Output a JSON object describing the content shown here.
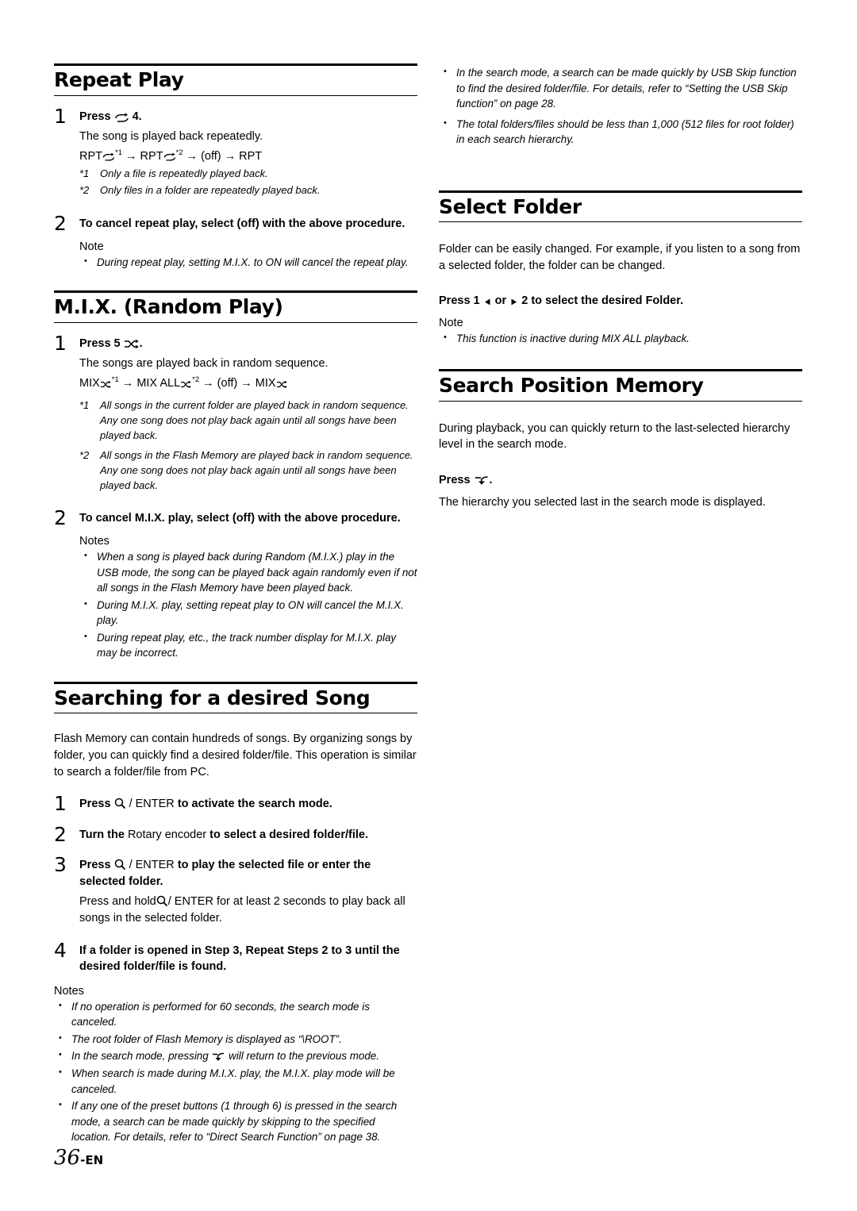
{
  "page": {
    "number": "36",
    "lang_suffix": "-EN"
  },
  "left_column": {
    "repeat_play": {
      "heading": "Repeat Play",
      "step1": {
        "num": "1",
        "title_pre": "Press",
        "title_post": "4.",
        "icon": "repeat-icon",
        "body": "The song is played back repeatedly.",
        "sequence_parts": [
          "RPT",
          "*1",
          " → ",
          "RPT",
          "*2",
          " → (off) → RPT"
        ],
        "footnote1_mark": "*1",
        "footnote1": "Only a file is repeatedly played back.",
        "footnote2_mark": "*2",
        "footnote2": "Only files in a folder are repeatedly played back."
      },
      "step2": {
        "num": "2",
        "title": "To cancel repeat play, select (off) with the above procedure.",
        "note_label": "Note",
        "notes": [
          "During repeat play, setting M.I.X. to ON will cancel the repeat play."
        ]
      }
    },
    "mix_random_play": {
      "heading": "M.I.X. (Random Play)",
      "step1": {
        "num": "1",
        "title_pre": "Press 5",
        "title_post": ".",
        "icon": "shuffle-icon",
        "body": "The songs are played back in random sequence.",
        "sequence_parts": [
          "MIX",
          "*1",
          " → MIX ALL",
          "*2",
          " → (off) → MIX"
        ],
        "footnote1_mark": "*1",
        "footnote1": "All songs in the current folder are played back in random sequence. Any one song does not play back again until all songs have been played back.",
        "footnote2_mark": "*2",
        "footnote2": "All songs in the Flash Memory are played back in random sequence. Any one song does not play back again until all songs have been played back."
      },
      "step2": {
        "num": "2",
        "title": "To cancel M.I.X. play, select (off) with the above procedure.",
        "notes_label": "Notes",
        "notes": [
          "When a song is played back during Random (M.I.X.) play in the USB mode, the song can be played back again randomly even if not all songs in the Flash Memory have been played back.",
          "During M.I.X. play, setting repeat play to ON will cancel the M.I.X. play.",
          "During repeat play, etc., the track number display for M.I.X. play may be incorrect."
        ]
      }
    },
    "searching": {
      "heading": "Searching for a desired Song",
      "intro": "Flash Memory can contain hundreds of songs. By organizing songs by folder, you can quickly find a desired folder/file. This operation is similar to search a folder/file from PC.",
      "steps": [
        {
          "num": "1",
          "title_pre": "Press",
          "title_mid": "/ ENTER",
          "title_post": "to activate the search mode.",
          "icon": "magnifier-icon"
        },
        {
          "num": "2",
          "title_pre": "Turn the",
          "title_mid": "Rotary encoder",
          "title_post": "to select a desired folder/file."
        },
        {
          "num": "3",
          "title_pre": "Press",
          "title_mid": "/ ENTER",
          "title_post": "to play the selected file or enter the selected folder.",
          "icon": "magnifier-icon",
          "body_pre": "Press and hold",
          "body_mid": "/ ENTER",
          "body_post": "for at least 2 seconds to play back all songs in the selected folder."
        },
        {
          "num": "4",
          "title_pre": "If a folder is opened in Step 3, Repeat Steps 2 to 3 until the desired folder/file is found."
        }
      ],
      "notes_label": "Notes",
      "notes": [
        "If no operation is performed for 60 seconds, the search mode is canceled.",
        "The root folder of Flash Memory is displayed as “\\ROOT”.",
        "In the search mode, pressing  will return to the previous mode.",
        "When search is made during M.I.X. play, the M.I.X. play mode will be canceled.",
        "If any one of the preset buttons (1 through 6) is pressed in the search mode, a search can be made quickly by skipping to the specified location. For details, refer to “Direct Search Function” on page 38."
      ]
    }
  },
  "right_column": {
    "top_notes": [
      "In the search mode, a search can be made quickly by USB Skip function to find the desired folder/file. For details, refer to “Setting the USB Skip function” on page 28.",
      "The total folders/files should be less than 1,000 (512 files for root folder) in each search hierarchy."
    ],
    "select_folder": {
      "heading": "Select Folder",
      "body": "Folder can be easily changed. For example, if you listen to a song from a selected folder, the folder can be changed.",
      "press_pre": "Press 1",
      "press_mid": "or",
      "press_post": "2 to select the desired Folder.",
      "left_icon": "triangle-left-icon",
      "right_icon": "triangle-right-icon",
      "note_label": "Note",
      "notes": [
        "This function is inactive during MIX ALL playback."
      ]
    },
    "search_position_memory": {
      "heading": "Search Position Memory",
      "body": "During playback, you can quickly return to the last-selected hierarchy level in the search mode.",
      "press_pre": "Press",
      "press_post": ".",
      "icon": "return-icon",
      "result": "The hierarchy you selected last in the search mode is displayed."
    }
  }
}
